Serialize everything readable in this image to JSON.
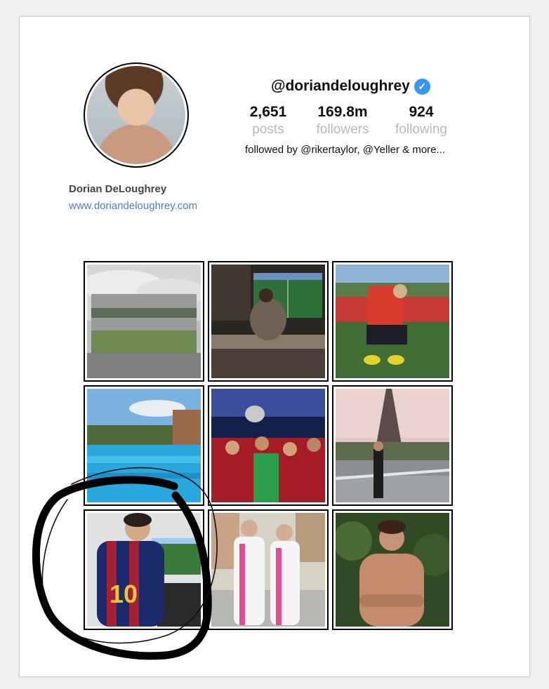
{
  "profile": {
    "handle": "@doriandeloughrey",
    "verified_icon": "verified-badge-icon",
    "stats": {
      "posts": {
        "value": "2,651",
        "label": "posts"
      },
      "followers": {
        "value": "169.8m",
        "label": "followers"
      },
      "following": {
        "value": "924",
        "label": "following"
      }
    },
    "followed_by": "followed by @rikertaylor, @Yeller & more...",
    "name": "Dorian DeLoughrey",
    "website": "www.doriandeloughrey.com"
  },
  "colors": {
    "verified": "#3897f0",
    "link": "#4a7fd6",
    "muted_label": "#b9b9b9",
    "annotation_ink": "#000000"
  },
  "grid": {
    "columns": 3,
    "rows": 3,
    "tiles": [
      {
        "scene": "cloudy-field"
      },
      {
        "scene": "person-watching-football-on-tv"
      },
      {
        "scene": "man-tying-boots-on-pitch"
      },
      {
        "scene": "pool-with-sea-view"
      },
      {
        "scene": "football-team-celebrating-trophy"
      },
      {
        "scene": "man-in-front-of-eiffel-tower"
      },
      {
        "scene": "man-in-messi-10-shirt"
      },
      {
        "scene": "two-girls-in-pink-white-tracksuits"
      },
      {
        "scene": "shirtless-man-in-garden"
      }
    ]
  },
  "annotation": {
    "type": "hand-drawn-circle",
    "target_tile": "man-in-messi-10-shirt"
  }
}
